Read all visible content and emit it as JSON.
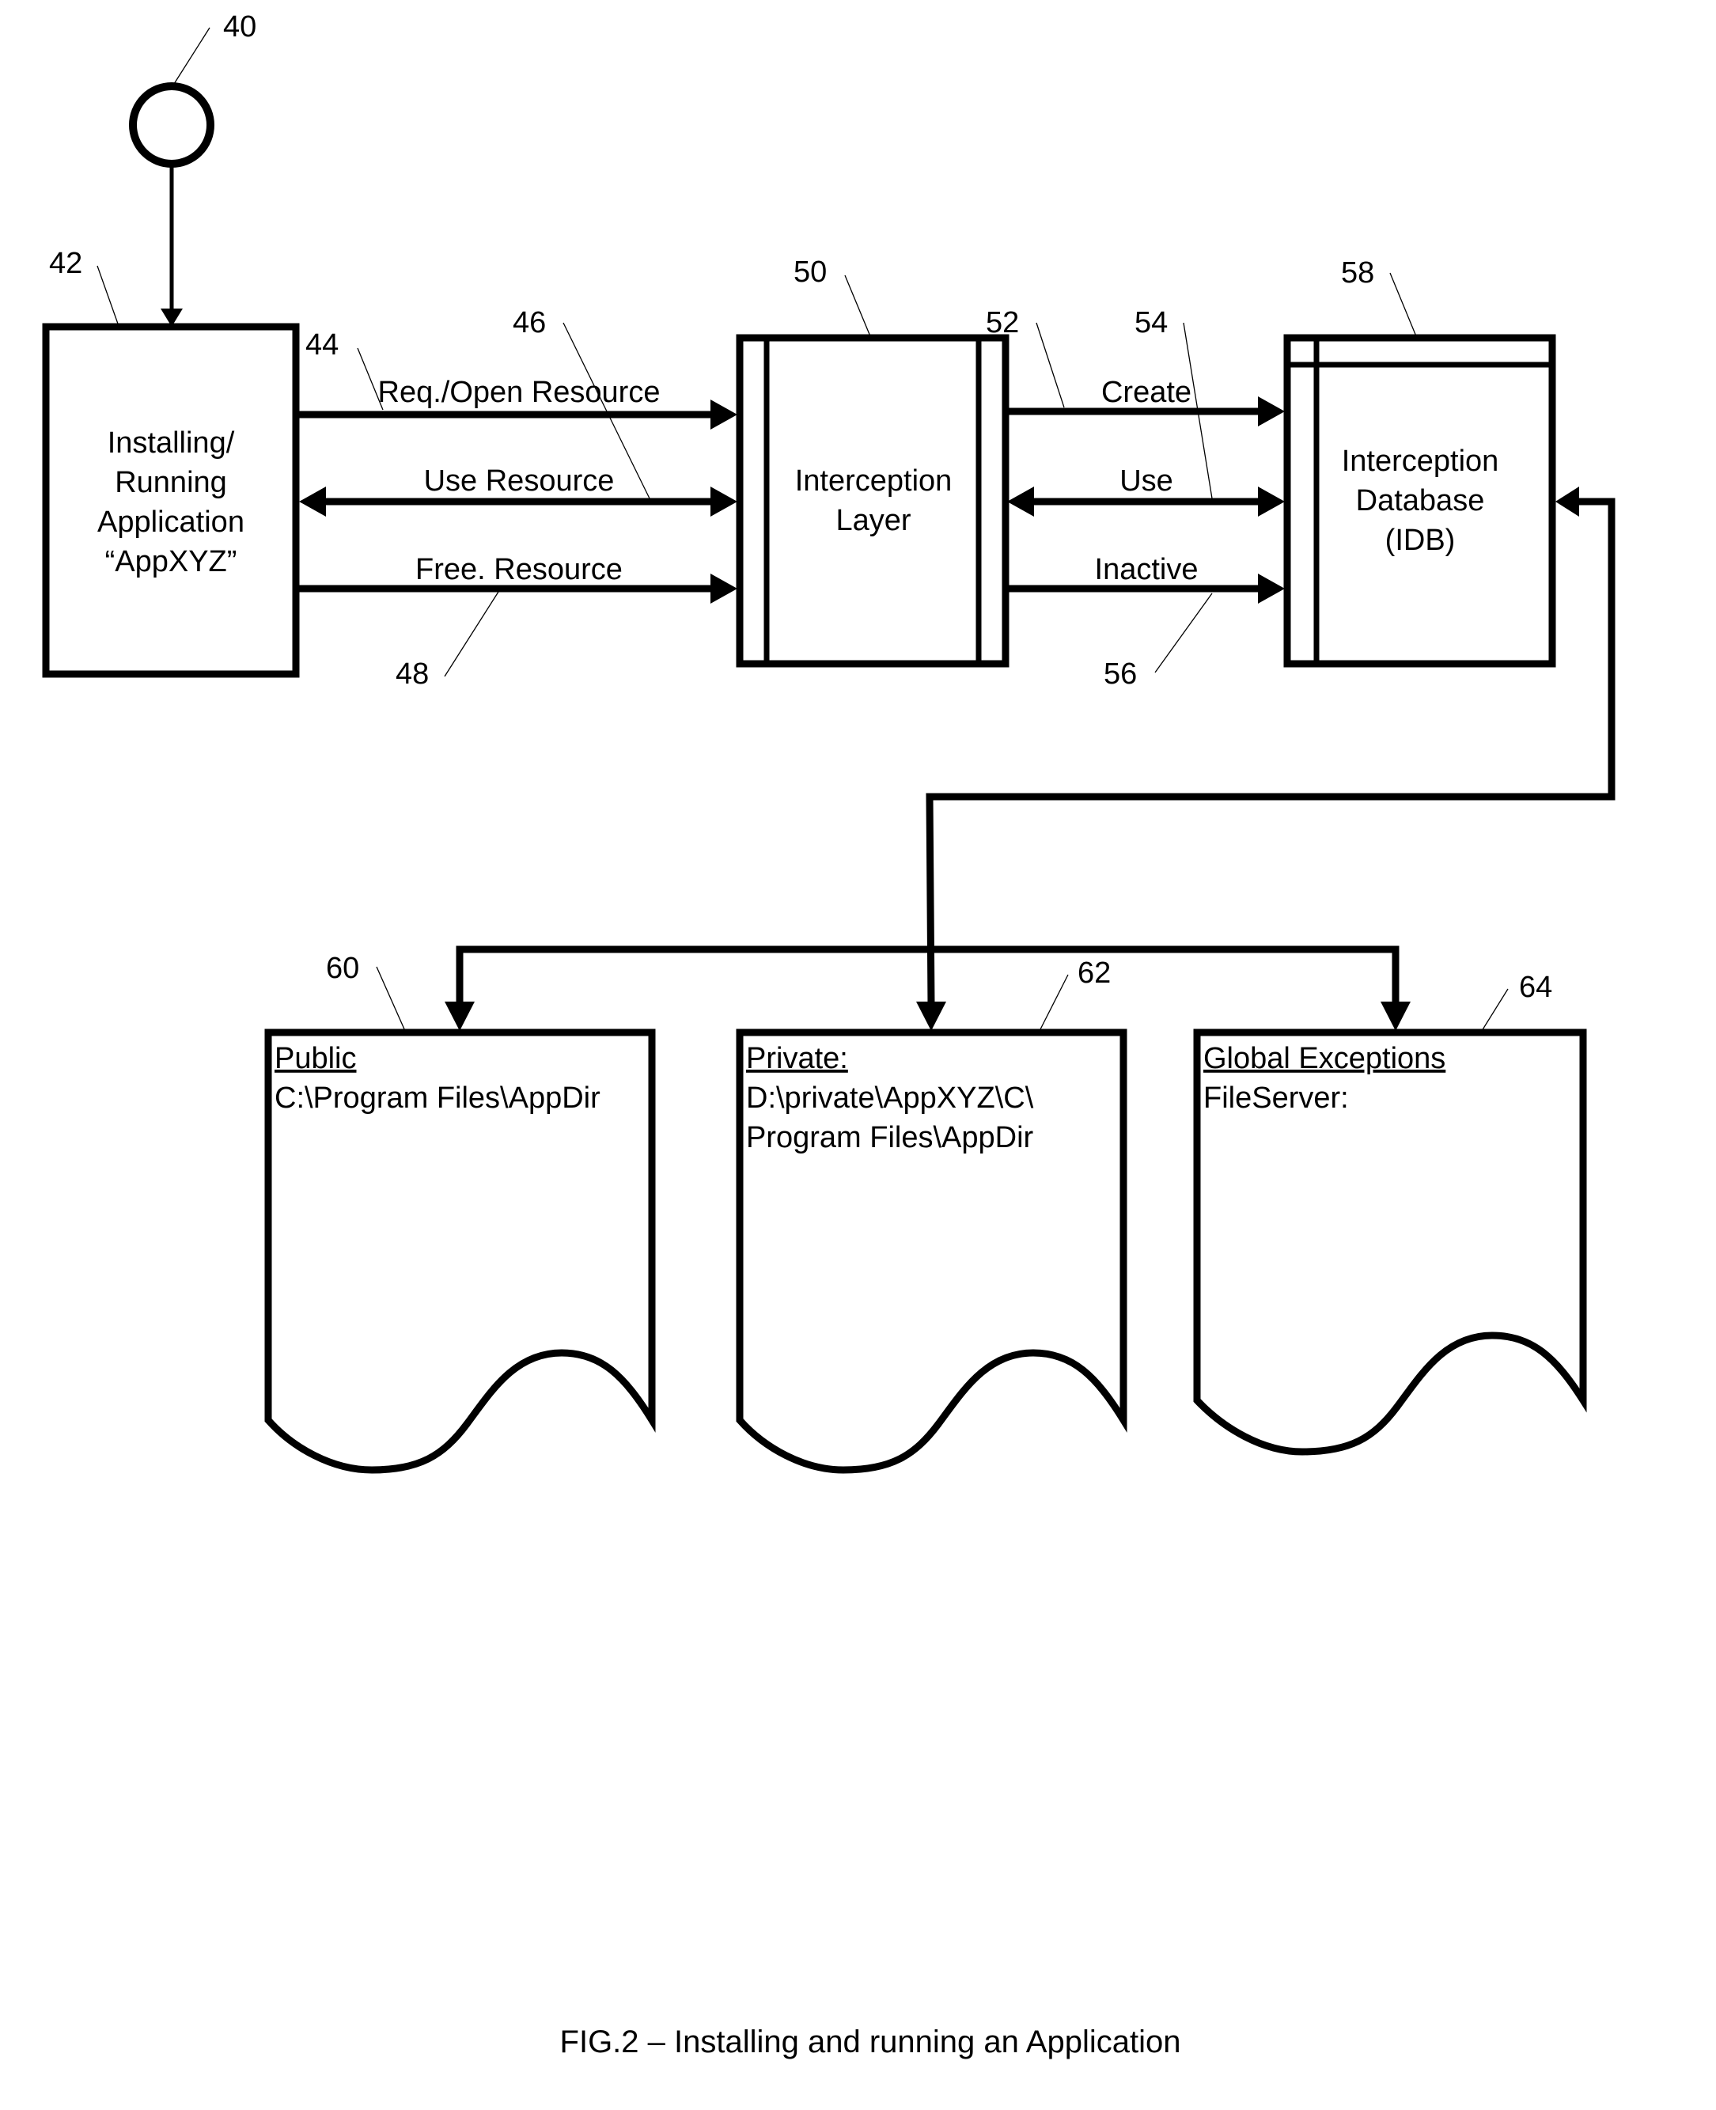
{
  "figure": {
    "caption": "FIG.2  – Installing and running an Application"
  },
  "nodes": {
    "start": {
      "ref": "40",
      "shape": "circle"
    },
    "application": {
      "ref": "42",
      "lines": [
        "Installing/",
        "Running",
        "Application",
        "“AppXYZ”"
      ]
    },
    "interception_layer": {
      "ref": "50",
      "lines": [
        "Interception",
        "Layer"
      ]
    },
    "interception_database": {
      "ref": "58",
      "lines": [
        "Interception",
        "Database",
        "(IDB)"
      ]
    },
    "doc_public": {
      "ref": "60",
      "title": "Public",
      "lines": [
        "C:\\Program Files\\AppDir"
      ]
    },
    "doc_private": {
      "ref": "62",
      "title": "Private:",
      "lines": [
        "D:\\private\\AppXYZ\\C\\",
        "Program Files\\AppDir"
      ]
    },
    "doc_global": {
      "ref": "64",
      "title": "Global Exceptions",
      "lines": [
        "FileServer:"
      ]
    }
  },
  "edges": {
    "req_open": {
      "ref": "44",
      "label": "Req./Open Resource",
      "direction": "right"
    },
    "use_resource": {
      "ref": "46",
      "label": "Use Resource",
      "direction": "both"
    },
    "free_resource": {
      "ref": "48",
      "label": "Free. Resource",
      "direction": "right"
    },
    "create": {
      "ref": "52",
      "label": "Create",
      "direction": "right"
    },
    "use": {
      "ref": "54",
      "label": "Use",
      "direction": "both"
    },
    "inactive": {
      "ref": "56",
      "label": "Inactive",
      "direction": "right"
    }
  }
}
